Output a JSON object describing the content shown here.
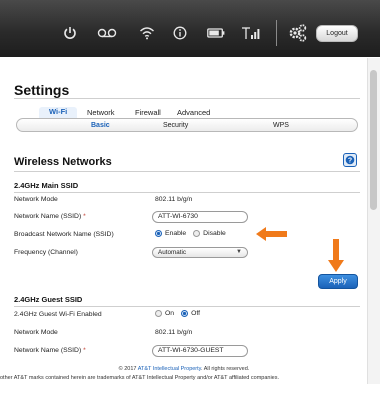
{
  "header": {
    "icons": [
      "power-icon",
      "voicemail-icon",
      "wifi-icon",
      "info-icon",
      "battery-icon",
      "signal-icon",
      "settings-icon"
    ],
    "logout_label": "Logout"
  },
  "page": {
    "title": "Settings",
    "main_tabs": [
      {
        "label": "Wi-Fi",
        "active": true
      },
      {
        "label": "Network",
        "active": false
      },
      {
        "label": "Firewall",
        "active": false
      },
      {
        "label": "Advanced",
        "active": false
      }
    ],
    "sub_tabs": [
      {
        "label": "Basic",
        "active": true
      },
      {
        "label": "Security",
        "active": false
      },
      {
        "label": "WPS",
        "active": false
      }
    ],
    "section_title": "Wireless Networks",
    "help_label": "?"
  },
  "main_ssid": {
    "title": "2.4GHz Main SSID",
    "network_mode_label": "Network Mode",
    "network_mode_value": "802.11 b/g/n",
    "ssid_label": "Network Name (SSID)",
    "required_mark": "*",
    "ssid_value": "ATT-WI-6730",
    "broadcast_label": "Broadcast Network Name (SSID)",
    "enable_label": "Enable",
    "disable_label": "Disable",
    "broadcast_selected": "Enable",
    "channel_label": "Frequency (Channel)",
    "channel_value": "Automatic"
  },
  "apply_label": "Apply",
  "guest_ssid": {
    "title": "2.4GHz Guest SSID",
    "enabled_label": "2.4GHz Guest Wi-Fi Enabled",
    "on_label": "On",
    "off_label": "Off",
    "enabled_selected": "Off",
    "network_mode_label": "Network Mode",
    "network_mode_value": "802.11 b/g/n",
    "ssid_label": "Network Name (SSID)",
    "required_mark": "*",
    "ssid_value": "ATT-WI-6730-GUEST"
  },
  "footer": {
    "copyright_prefix": "© 2017",
    "copyright_link": "AT&T Intellectual Property",
    "copyright_suffix": ". All rights reserved.",
    "trademark": "other AT&T marks contained herein are trademarks of AT&T Intellectual Property and/or AT&T affiliated companies."
  },
  "colors": {
    "header_bg": "#2b2b2b",
    "accent": "#1b62b8",
    "arrow": "#f07a1a"
  }
}
